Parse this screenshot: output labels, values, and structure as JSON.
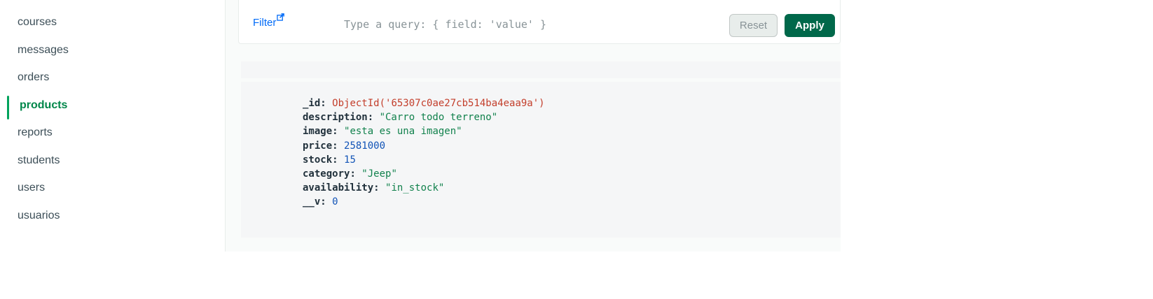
{
  "sidebar": {
    "items": [
      {
        "label": "courses",
        "active": false
      },
      {
        "label": "messages",
        "active": false
      },
      {
        "label": "orders",
        "active": false
      },
      {
        "label": "products",
        "active": true
      },
      {
        "label": "reports",
        "active": false
      },
      {
        "label": "students",
        "active": false
      },
      {
        "label": "users",
        "active": false
      },
      {
        "label": "usuarios",
        "active": false
      }
    ]
  },
  "filter": {
    "label": "Filter",
    "placeholder": "Type a query: { field: 'value' }",
    "value": "",
    "reset_label": "Reset",
    "apply_label": "Apply"
  },
  "document": {
    "fields": [
      {
        "key": "_id",
        "value": "ObjectId('65307c0ae27cb514ba4eaa9a')",
        "type": "oid"
      },
      {
        "key": "description",
        "value": "\"Carro todo terreno\"",
        "type": "str"
      },
      {
        "key": "image",
        "value": "\"esta es una imagen\"",
        "type": "str"
      },
      {
        "key": "price",
        "value": "2581000",
        "type": "num"
      },
      {
        "key": "stock",
        "value": "15",
        "type": "num"
      },
      {
        "key": "category",
        "value": "\"Jeep\"",
        "type": "str"
      },
      {
        "key": "availability",
        "value": "\"in_stock\"",
        "type": "str"
      },
      {
        "key": "__v",
        "value": "0",
        "type": "num"
      }
    ]
  },
  "colors": {
    "accent": "#00a35c",
    "active_text": "#00874a",
    "apply_button": "#00684a",
    "link": "#016bf8",
    "oid": "#c33e2b",
    "string": "#12824d",
    "number": "#1254b7"
  },
  "icons": {
    "filter_link": "external-link-icon"
  }
}
